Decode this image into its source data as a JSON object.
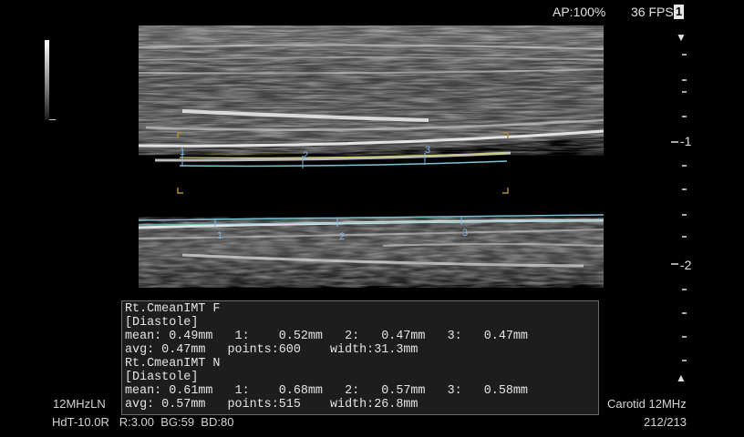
{
  "status_bar": {
    "ap": "AP:100%",
    "fps": "36 FPS",
    "fps_badge": "1"
  },
  "depth_scale": {
    "labels": [
      "-1",
      "-2"
    ]
  },
  "markers": {
    "far_wall": [
      "1",
      "2",
      "3"
    ],
    "near_wall": [
      "1",
      "2",
      "3"
    ]
  },
  "measurement": {
    "lines": [
      "Rt.CmeanIMT F",
      "[Diastole]",
      "mean: 0.49mm   1:    0.52mm   2:   0.47mm   3:   0.47mm",
      "avg: 0.47mm   points:600    width:31.3mm",
      "Rt.CmeanIMT N",
      "[Diastole]",
      "mean: 0.61mm   1:    0.68mm   2:   0.57mm   3:   0.58mm",
      "avg: 0.57mm   points:515    width:26.8mm"
    ]
  },
  "bottom_left": {
    "probe": "12MHzLN",
    "settings": "HdT-10.0R   R:3.00  BG:59  BD:80"
  },
  "bottom_right": {
    "exam": "Carotid 12MHz",
    "frame": "212/213"
  },
  "colors": {
    "far_wall_trace": "#c8cc6a",
    "near_wall_trace": "#7cc4d4",
    "marker": "#7fb6e6",
    "roi_bracket": "#b38a3a"
  }
}
